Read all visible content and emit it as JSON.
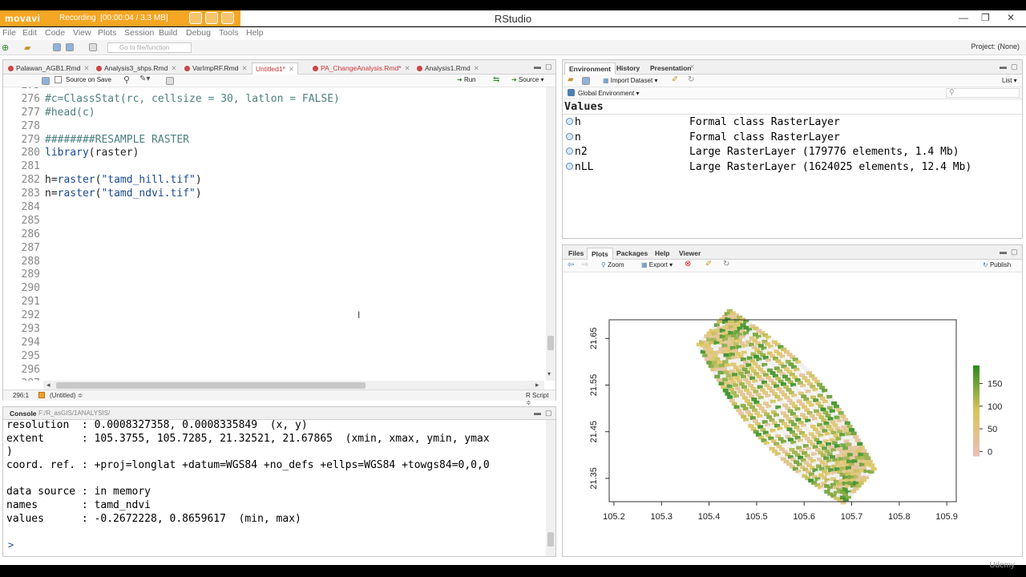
{
  "recorder": {
    "logo": "movavi",
    "status": "Recording",
    "time": "[00:00:04 / 3.3 MB]"
  },
  "window": {
    "title": "RStudio",
    "minimize": "—",
    "maximize": "❐",
    "close": "✕"
  },
  "menu": [
    "File",
    "Edit",
    "Code",
    "View",
    "Plots",
    "Session",
    "Build",
    "Debug",
    "Tools",
    "Help"
  ],
  "toolbar": {
    "goto_placeholder": "Go to file/function",
    "project": "Project: (None)"
  },
  "editor": {
    "tabs": [
      {
        "label": "Palawan_AGB1.Rmd"
      },
      {
        "label": "Analysis3_shps.Rmd"
      },
      {
        "label": "VarImpRF.Rmd"
      },
      {
        "label": "Untitled1*"
      },
      {
        "label": "PA_ChangeAnalysis.Rmd*"
      },
      {
        "label": "Analysis1.Rmd"
      }
    ],
    "source_on_save": "Source on Save",
    "run_label": "Run",
    "source_label": "Source",
    "lines": [
      {
        "n": "275",
        "text": ""
      },
      {
        "n": "276",
        "text": "#c=ClassStat(rc, cellsize = 30, latlon = FALSE)"
      },
      {
        "n": "277",
        "text": "#head(c)"
      },
      {
        "n": "278",
        "text": ""
      },
      {
        "n": "279",
        "text": "########RESAMPLE RASTER"
      },
      {
        "n": "280",
        "text": "library(raster)"
      },
      {
        "n": "281",
        "text": ""
      },
      {
        "n": "282",
        "text": "h=raster(\"tamd_hill.tif\")"
      },
      {
        "n": "283",
        "text": "n=raster(\"tamd_ndvi.tif\")"
      },
      {
        "n": "284",
        "text": ""
      },
      {
        "n": "285",
        "text": ""
      },
      {
        "n": "286",
        "text": ""
      },
      {
        "n": "287",
        "text": ""
      },
      {
        "n": "288",
        "text": ""
      },
      {
        "n": "289",
        "text": ""
      },
      {
        "n": "290",
        "text": ""
      },
      {
        "n": "291",
        "text": ""
      },
      {
        "n": "292",
        "text": ""
      },
      {
        "n": "293",
        "text": ""
      },
      {
        "n": "294",
        "text": ""
      },
      {
        "n": "295",
        "text": ""
      },
      {
        "n": "296",
        "text": ""
      },
      {
        "n": "297",
        "text": ""
      }
    ],
    "status_pos": "296:1",
    "status_scope": "(Untitled) ≑",
    "status_type": "R Script ≑"
  },
  "console": {
    "title": "Console",
    "path": "F:/R_asGIS/1ANALYSIS/",
    "output": [
      "resolution  : 0.0008327358, 0.0008335849  (x, y)",
      "extent      : 105.3755, 105.7285, 21.32521, 21.67865  (xmin, xmax, ymin, ymax",
      ")",
      "coord. ref. : +proj=longlat +datum=WGS84 +no_defs +ellps=WGS84 +towgs84=0,0,0",
      "",
      "data source : in memory",
      "names       : tamd_ndvi",
      "values      : -0.2672228, 0.8659617  (min, max)"
    ],
    "prompt": ">"
  },
  "environment": {
    "tabs": [
      "Environment",
      "History",
      "Presentation"
    ],
    "import_label": "Import Dataset ▾",
    "list_label": "List ▾",
    "scope_label": "Global Environment ▾",
    "section": "Values",
    "rows": [
      {
        "name": "h",
        "value": "Formal class RasterLayer"
      },
      {
        "name": "n",
        "value": "Formal class RasterLayer"
      },
      {
        "name": "n2",
        "value": "Large RasterLayer (179776 elements, 1.4 Mb)"
      },
      {
        "name": "nLL",
        "value": "Large RasterLayer (1624025 elements, 12.4 Mb)"
      }
    ]
  },
  "files_pane": {
    "tabs": [
      "Files",
      "Plots",
      "Packages",
      "Help",
      "Viewer"
    ],
    "zoom_label": "Zoom",
    "export_label": "Export ▾",
    "publish_label": "Publish"
  },
  "chart_data": {
    "type": "heatmap",
    "title": "",
    "xlabel": "",
    "ylabel": "",
    "x_ticks": [
      "105.2",
      "105.3",
      "105.4",
      "105.5",
      "105.6",
      "105.7",
      "105.8",
      "105.9"
    ],
    "y_ticks": [
      "21.35",
      "21.45",
      "21.55",
      "21.65"
    ],
    "xlim": [
      105.19,
      105.92
    ],
    "ylim": [
      21.3,
      21.69
    ],
    "extent": {
      "xmin": 105.3755,
      "xmax": 105.7285,
      "ymin": 21.32521,
      "ymax": 21.67865
    },
    "legend_ticks": [
      "150",
      "100",
      "50",
      "0"
    ],
    "legend_range": [
      -10,
      190
    ],
    "colors": {
      "low": "#e8c0b8",
      "mid": "#d9c45a",
      "high": "#2a8a1e"
    },
    "legend_placement": "right"
  },
  "watermark": "Udemy"
}
